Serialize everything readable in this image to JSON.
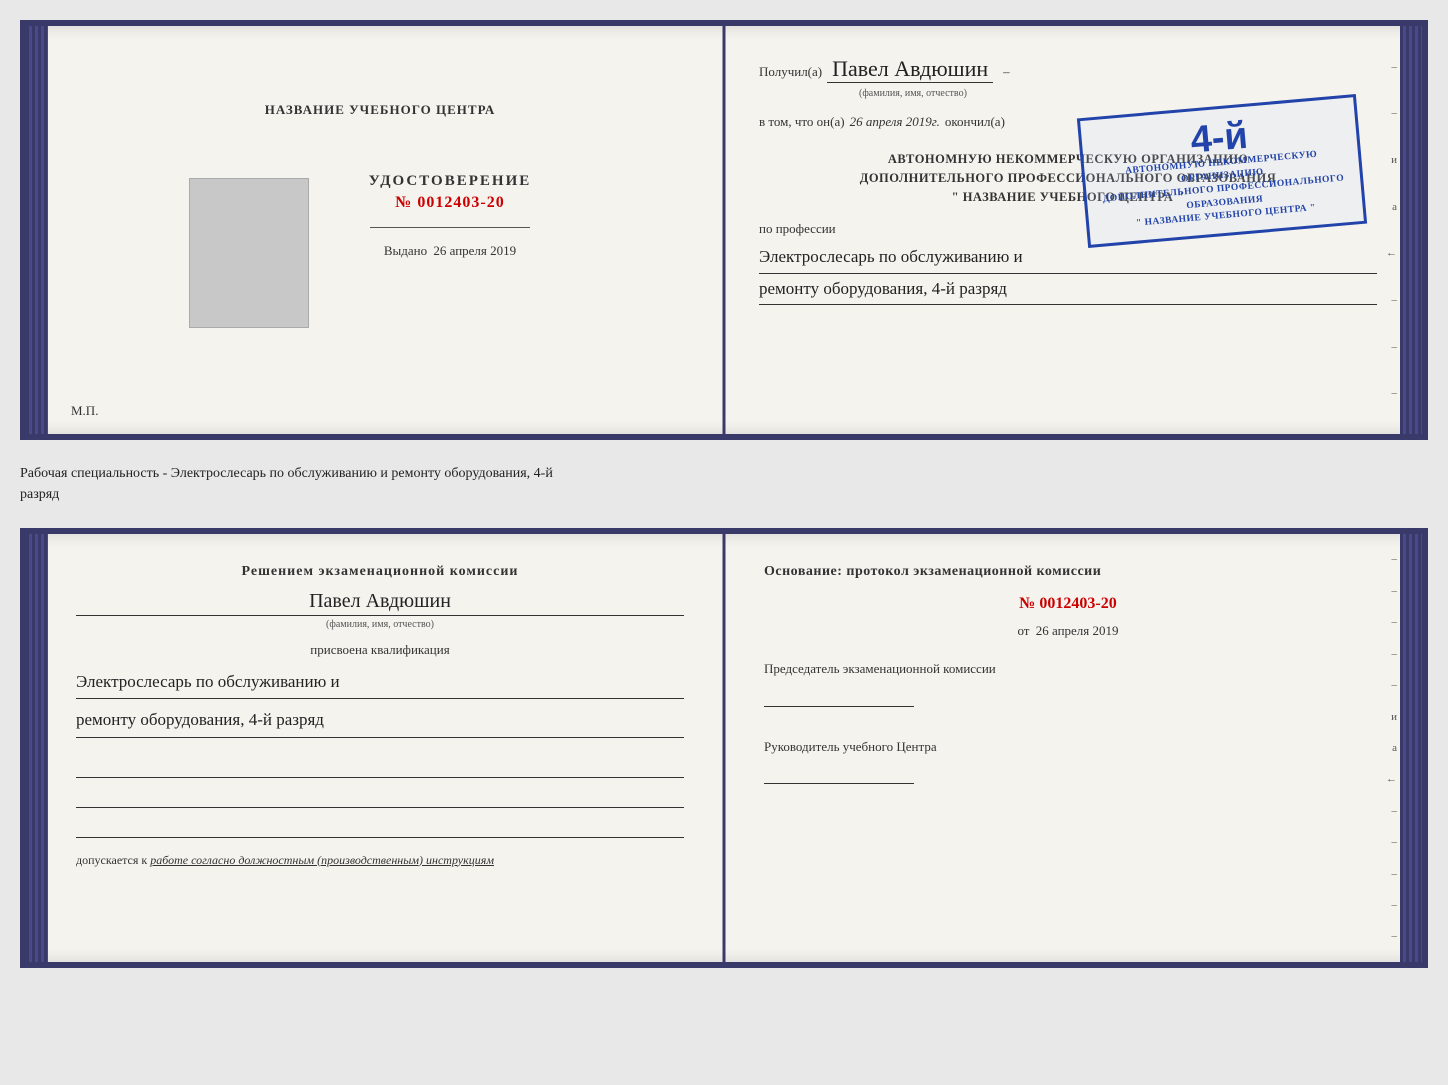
{
  "top_doc": {
    "left": {
      "binding_left": true,
      "center_title": "НАЗВАНИЕ УЧЕБНОГО ЦЕНТРА",
      "udostoverenie_label": "УДОСТОВЕРЕНИЕ",
      "number_prefix": "№",
      "number_value": "0012403-20",
      "vydano_label": "Выдано",
      "vydano_date": "26 апреля 2019",
      "mp_label": "М.П."
    },
    "right": {
      "received_prefix": "Получил(а)",
      "received_name": "Павел Авдюшин",
      "fio_label": "(фамилия, имя, отчество)",
      "vtom_prefix": "в том, что он(а)",
      "vtom_date": "26 апреля 2019г.",
      "okonchil_label": "окончил(а)",
      "stamp": {
        "big_number": "4-й",
        "line1": "АВТОНОМНУЮ НЕКОММЕРЧЕСКУЮ ОРГАНИЗАЦИЮ",
        "line2": "ДОПОЛНИТЕЛЬНОГО ПРОФЕССИОНАЛЬНОГО ОБРАЗОВАНИЯ",
        "line3": "\" НАЗВАНИЕ УЧЕБНОГО ЦЕНТРА \""
      },
      "po_professii_label": "по профессии",
      "profession_line1": "Электрослесарь по обслуживанию и",
      "profession_line2": "ремонту оборудования, 4-й разряд"
    }
  },
  "between_text": {
    "line1": "Рабочая специальность - Электрослесарь по обслуживанию и ремонту оборудования, 4-й",
    "line2": "разряд"
  },
  "bottom_doc": {
    "left": {
      "resheniem_title": "Решением экзаменационной комиссии",
      "person_name": "Павел Авдюшин",
      "fio_label": "(фамилия, имя, отчество)",
      "prisvoena_label": "присвоена квалификация",
      "qual_line1": "Электрослесарь по обслуживанию и",
      "qual_line2": "ремонту оборудования, 4-й разряд",
      "dopuskaetsya_prefix": "допускается к",
      "dopuskaetsya_value": "работе согласно должностным (производственным) инструкциям"
    },
    "right": {
      "osnovanie_label": "Основание: протокол экзаменационной комиссии",
      "number_prefix": "№",
      "number_value": "0012403-20",
      "ot_prefix": "от",
      "ot_date": "26 апреля 2019",
      "predsedatel_label": "Председатель экзаменационной комиссии",
      "rukovoditel_label": "Руководитель учебного Центра"
    }
  },
  "edge_marks": {
    "top_right": [
      "–",
      "–",
      "и",
      "а",
      "←",
      "–",
      "–",
      "–"
    ],
    "bottom_right": [
      "–",
      "–",
      "–",
      "–",
      "–",
      "и",
      "а",
      "←",
      "–",
      "–",
      "–",
      "–",
      "–"
    ]
  }
}
